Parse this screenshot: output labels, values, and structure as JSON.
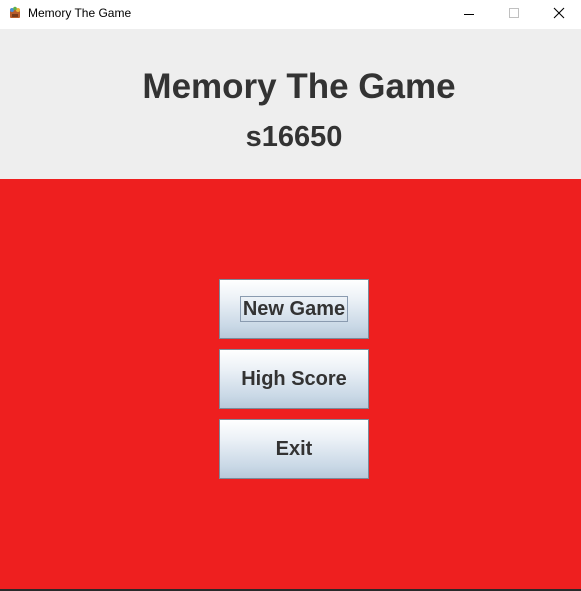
{
  "window": {
    "title": "Memory The Game"
  },
  "header": {
    "game_title": "Memory The Game",
    "student_id": "s16650"
  },
  "menu": {
    "new_game_label": "New Game",
    "high_score_label": "High Score",
    "exit_label": "Exit"
  },
  "colors": {
    "header_background": "#eeeeee",
    "main_background": "#ee1f1f",
    "text": "#333333"
  }
}
